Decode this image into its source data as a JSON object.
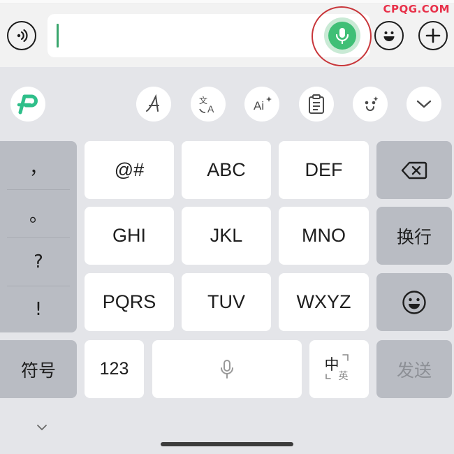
{
  "watermark": "CPQG.COM",
  "chat_bar": {
    "voice_toggle_icon": "voice-wave-icon",
    "input_value": "",
    "mic_icon": "microphone-icon",
    "emoji_icon": "smiley-icon",
    "add_icon": "plus-icon"
  },
  "toolbar": {
    "logo_icon": "p-logo-icon",
    "items": [
      "handwriting-font-icon",
      "translate-icon",
      "ai-assist-icon",
      "clipboard-icon",
      "emoji-face-icon",
      "chevron-down-icon"
    ]
  },
  "keyboard": {
    "punctuation": [
      "，",
      "。",
      "?",
      "!"
    ],
    "keys": {
      "k1": "@#",
      "k2": "ABC",
      "k3": "DEF",
      "k4": "GHI",
      "k5": "JKL",
      "k6": "MNO",
      "k7": "PQRS",
      "k8": "TUV",
      "k9": "WXYZ"
    },
    "backspace_icon": "backspace-icon",
    "newline": "换行",
    "emoji_key_icon": "smiley-icon",
    "symbols": "符号",
    "num_mode": "123",
    "space_icon": "microphone-icon",
    "lang_switch": {
      "primary": "中",
      "secondary": "英"
    },
    "send": "发送"
  },
  "colors": {
    "accent_green": "#3fbf76",
    "highlight_red": "#c8363a",
    "watermark_red": "#e8314a"
  }
}
